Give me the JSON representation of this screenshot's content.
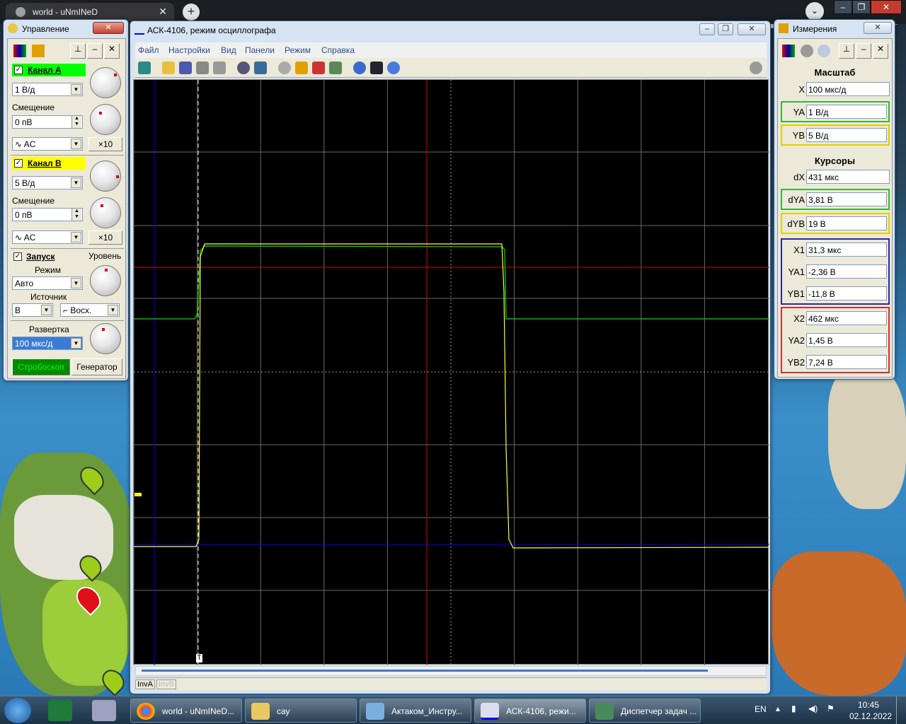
{
  "chrome": {
    "tab_title": "world - uNmINeD",
    "new_tab": "+",
    "close": "✕"
  },
  "control_panel": {
    "title": "Управление",
    "channel_a": {
      "label": "Канал А",
      "scale": "1 В/д",
      "offset_label": "Смещение",
      "offset": "0 пВ",
      "coupling": "AC",
      "x10": "×10"
    },
    "channel_b": {
      "label": "Канал В",
      "scale": "5 В/д",
      "offset_label": "Смещение",
      "offset": "0 пВ",
      "coupling": "AC",
      "x10": "×10"
    },
    "trigger": {
      "label": "Запуск",
      "level_label": "Уровень",
      "mode_label": "Режим",
      "mode": "Авто",
      "source_label": "Источник",
      "source": "B",
      "edge": "Восх."
    },
    "sweep": {
      "label": "Развертка",
      "value": "100 мкс/д"
    },
    "buttons": {
      "strobe": "Стробоскоп",
      "generator": "Генератор"
    }
  },
  "oscilloscope": {
    "title": "АСК-4106, режим осциллографа",
    "menu": [
      "Файл",
      "Настройки",
      "Вид",
      "Панели",
      "Режим",
      "Справка"
    ],
    "trigger_marker": "T",
    "status": {
      "inv_a": "InvA",
      "inv_b": "InvB"
    }
  },
  "measurements": {
    "title": "Измерения",
    "scale_header": "Масштаб",
    "scale": {
      "X": "100 мкс/д",
      "YA": "1 В/д",
      "YB": "5 В/д"
    },
    "cursors_header": "Курсоры",
    "cursors": {
      "dX": "431 мкс",
      "dYA": "3,81 В",
      "dYB": "19 В",
      "X1": "31,3 мкс",
      "YA1": "-2,36 В",
      "YB1": "-11,8 В",
      "X2": "462 мкс",
      "YA2": "1,45 В",
      "YB2": "7,24 В"
    },
    "labels": {
      "X": "X",
      "YA": "YA",
      "YB": "YB",
      "dX": "dX",
      "dYA": "dYA",
      "dYB": "dYB",
      "X1": "X1",
      "YA1": "YA1",
      "YB1": "YB1",
      "X2": "X2",
      "YA2": "YA2",
      "YB2": "YB2"
    }
  },
  "taskbar": {
    "tasks": [
      "world - uNmINeD...",
      "сау",
      "Актаком_Инстру...",
      "АСК-4106, режи...",
      "Диспетчер задач ..."
    ],
    "lang": "EN",
    "time": "10:45",
    "date": "02.12.2022"
  },
  "colors": {
    "channel_a": "#00ff00",
    "channel_b": "#ffff00",
    "cursor1": "#0000ff",
    "cursor2": "#ff0000"
  }
}
